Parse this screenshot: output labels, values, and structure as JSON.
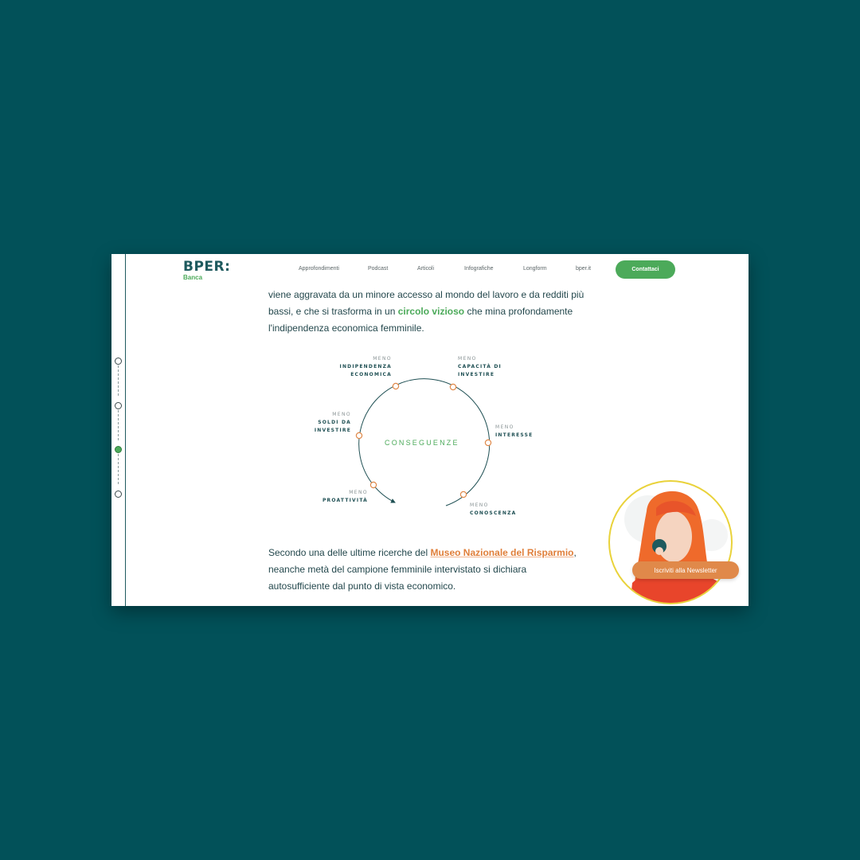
{
  "nav": {
    "logo_main": "BPER:",
    "logo_sub": "Banca",
    "items": [
      "Approfondimenti",
      "Podcast",
      "Articoli",
      "Infografiche",
      "Longform",
      "bper.it"
    ],
    "cta_label": "Contattaci"
  },
  "article": {
    "para1_a": "viene aggravata da un minore accesso al mondo del lavoro e da redditi più bassi, e che si trasforma in un ",
    "para1_highlight": "circolo vizioso",
    "para1_b": " che mina profondamente l'indipendenza economica femminile.",
    "para2_a": "Secondo una delle ultime ricerche del ",
    "para2_link": "Museo Nazionale del Risparmio",
    "para2_b": ", neanche metà del campione femminile intervistato si dichiara autosufficiente dal punto di vista economico."
  },
  "diagram": {
    "center": "CONSEGUENZE",
    "nodes": [
      {
        "pre": "MENO",
        "main": "INDIPENDENZA ECONOMICA"
      },
      {
        "pre": "MENO",
        "main": "CAPACITÀ DI INVESTIRE"
      },
      {
        "pre": "MENO",
        "main": "INTERESSE"
      },
      {
        "pre": "MENO",
        "main": "CONOSCENZA"
      },
      {
        "pre": "MENO",
        "main": "PROATTIVITÀ"
      },
      {
        "pre": "MENO",
        "main": "SOLDI DA INVESTIRE"
      }
    ]
  },
  "newsletter": {
    "label": "Iscriviti alla Newsletter"
  },
  "colors": {
    "background": "#025159",
    "brand_dark": "#1e5a5e",
    "accent_green": "#4caa5a",
    "accent_orange": "#e07f3a"
  }
}
